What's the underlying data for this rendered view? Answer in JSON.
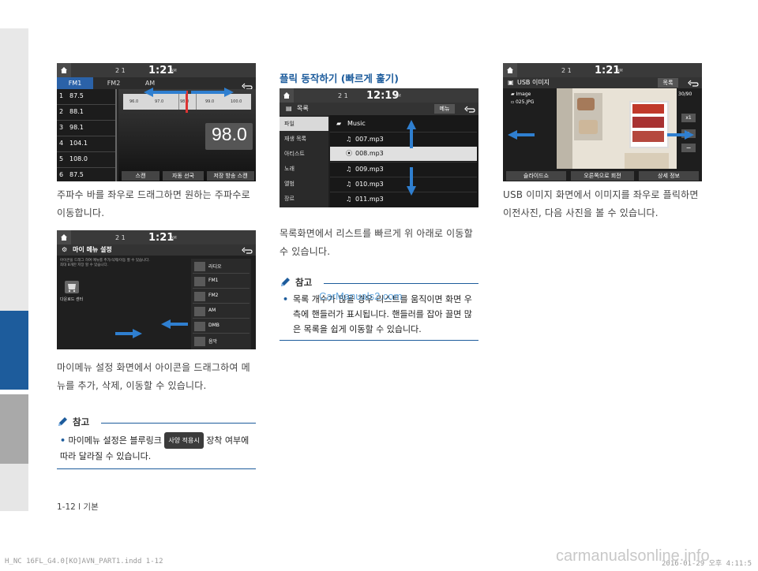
{
  "screen_radio": {
    "indicators": "2 1",
    "time": "1:21",
    "ampm": "AM",
    "tabs": [
      "FM1",
      "FM2",
      "AM"
    ],
    "presets": [
      {
        "num": "1",
        "freq": "87.5"
      },
      {
        "num": "2",
        "freq": "88.1"
      },
      {
        "num": "3",
        "freq": "98.1"
      },
      {
        "num": "4",
        "freq": "104.1"
      },
      {
        "num": "5",
        "freq": "108.0"
      },
      {
        "num": "6",
        "freq": "87.5"
      }
    ],
    "scale": [
      "96.0",
      "97.0",
      "98.0",
      "99.0",
      "100.0"
    ],
    "current_freq": "98.0",
    "buttons": [
      "스캔",
      "자동 선국",
      "저장 방송 스캔"
    ]
  },
  "caption_radio": "주파수 바를 좌우로 드래그하면 원하는 주파수로 이동합니다.",
  "screen_mymenu": {
    "indicators": "2 1",
    "time": "1:21",
    "ampm": "AM",
    "title": "마이 메뉴 설정",
    "desc1": "아이콘을 드래그 하여 메뉴를 추가/삭제/이동 할 수 있습니다.",
    "desc2": "최대 8개만 저장 할 수 있습니다.",
    "icon_label": "다운로드 센터",
    "items": [
      "라디오",
      "FM1",
      "FM2",
      "AM",
      "DMB",
      "음악"
    ]
  },
  "caption_mymenu": "마이메뉴 설정 화면에서 아이콘을 드래그하여 메뉴를 추가, 삭제, 이동할 수 있습니다.",
  "note1": {
    "title": "참고",
    "text_before": "마이메뉴 설정은 블루링크",
    "badge": "사양 적용시",
    "text_after": "장착 여부에 따라 달라질 수 있습니다."
  },
  "section_flick": {
    "title": "플릭 동작하기 (빠르게 훑기)"
  },
  "screen_music": {
    "indicators": "2 1",
    "time": "12:19",
    "ampm": "AM",
    "title": "목록",
    "menu_btn": "메뉴",
    "categories": [
      "파일",
      "재생 목록",
      "아티스트",
      "노래",
      "앨범",
      "장르"
    ],
    "folder": "Music",
    "files": [
      "007.mp3",
      "008.mp3",
      "009.mp3",
      "010.mp3",
      "011.mp3"
    ]
  },
  "caption_music": "목록화면에서 리스트를 빠르게 위 아래로 이동할 수 있습니다.",
  "note2": {
    "title": "참고",
    "text": "목록 개수가 많을 경우 리스트를 움직이면 화면 우측에 핸들러가 표시됩니다. 핸들러를 잡아 끌면 많은 목록을 쉽게 이동할 수 있습니다."
  },
  "screen_usb": {
    "indicators": "2 1",
    "time": "1:21",
    "ampm": "AM",
    "title": "USB 이미지",
    "list_btn": "목록",
    "folder": "Image",
    "file": "025.JPG",
    "counter": "30/90",
    "zoom": "x1",
    "buttons": [
      "슬라이드쇼",
      "오른쪽으로 회전",
      "상세 정보"
    ]
  },
  "caption_usb": "USB 이미지 화면에서 이미지를 좌우로 플릭하면 이전사진, 다음 사진을 볼 수 있습니다.",
  "footer": {
    "page": "1-12 l 기본",
    "file": "H_NC 16FL_G4.0[KO]AVN_PART1.indd   1-12",
    "date": "2016-01-29   오후 4:11:5",
    "watermark": "carmanualsonline.info",
    "watermark2": "CarManuals2.com"
  },
  "colors": {
    "accent": "#1d5c9c",
    "arrow": "#2f7fd0",
    "highlight": "#5aa0e8"
  }
}
